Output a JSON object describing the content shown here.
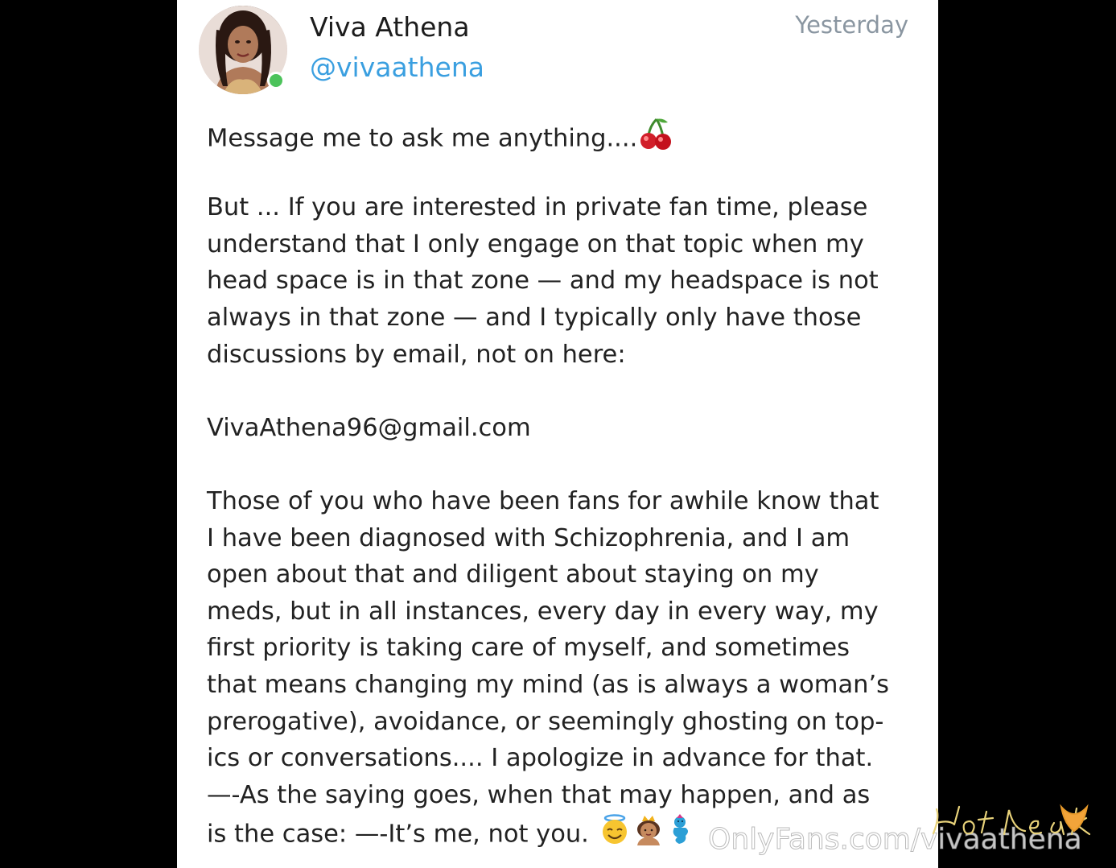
{
  "post": {
    "author_name": "Viva Athena",
    "author_handle": "@vivaathena",
    "timestamp": "Yesterday",
    "online": true,
    "lines": [
      "Message me to ask me anything....",
      "",
      "But ... If you are interested in private fan time, please",
      "understand that I only engage on that topic when my",
      "head space is in that zone — and my headspace is not",
      "always in that zone — and I typically only have those",
      "discussions by email, not on here:",
      "",
      "VivaAthena96@gmail.com",
      "",
      "Those of you who have been fans for awhile know that",
      "I have been diagnosed with Schizophrenia, and I am",
      "open about that and diligent about staying on my",
      "meds, but in all instances, every day in every way, my",
      "first priority is taking care of myself, and sometimes",
      "that means changing my mind (as is always a woman’s",
      "prerogative), avoidance, or seemingly ghosting on top-",
      "ics or conversations.... I apologize in advance for that.",
      "—-As the saying goes, when that may happen, and as",
      "is the case: —-It’s me, not you."
    ],
    "emoji_after_line_1": "cherries-emoji",
    "emoji_after_last_line": [
      "angel-smile-emoji",
      "princess-emoji",
      "genie-emoji"
    ]
  },
  "watermark": {
    "text": "OnlyFans.com/vivaathena",
    "logo_text": "Hot Leak"
  },
  "colors": {
    "handle": "#3a9fe0",
    "timestamp": "#8a96a1",
    "online": "#4cc35b",
    "text": "#222222"
  }
}
